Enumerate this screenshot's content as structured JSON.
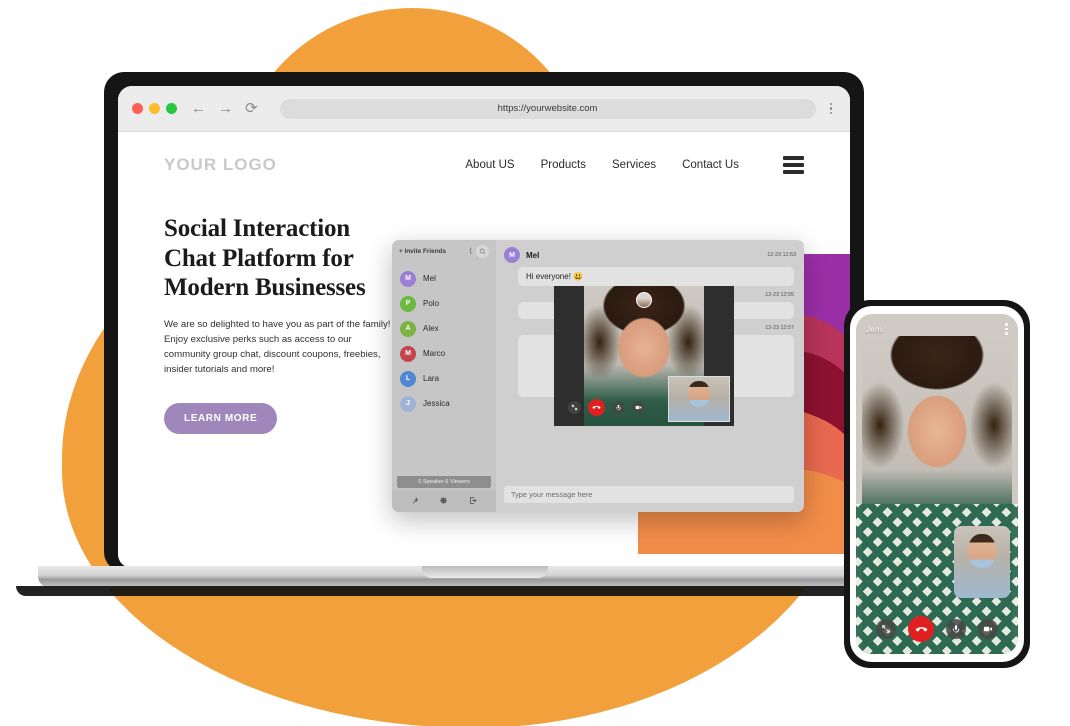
{
  "browser": {
    "url": "https://yourwebsite.com",
    "back_icon": "←",
    "forward_icon": "→",
    "reload_icon": "⟳",
    "menu_icon": "kebab-menu-icon",
    "traffic_lights": [
      "close",
      "minimize",
      "maximize"
    ]
  },
  "site": {
    "logo": "YOUR LOGO",
    "nav": [
      {
        "label": "About US"
      },
      {
        "label": "Products"
      },
      {
        "label": "Services"
      },
      {
        "label": "Contact Us"
      }
    ],
    "menu_icon": "hamburger-icon"
  },
  "hero": {
    "heading": "Social Interaction Chat Platform for Modern Businesses",
    "body": "We are so delighted to have you as part of the family! Enjoy exclusive perks such as access to our community group chat, discount coupons, freebies, insider tutorials and more!",
    "cta_label": "LEARN MORE",
    "cta_color": "#9f87bb"
  },
  "chat_app": {
    "sidebar": {
      "invite_label": "+ Invite Friends",
      "collapse_icon": "chevron-left-icon",
      "search_icon": "search-icon",
      "contacts": [
        {
          "initial": "M",
          "name": "Mel",
          "color": "#9b7fd4"
        },
        {
          "initial": "P",
          "name": "Polo",
          "color": "#6cb93f"
        },
        {
          "initial": "A",
          "name": "Alex",
          "color": "#7cb342"
        },
        {
          "initial": "M",
          "name": "Marco",
          "color": "#c3444f"
        },
        {
          "initial": "L",
          "name": "Lara",
          "color": "#4f86d6"
        },
        {
          "initial": "J",
          "name": "Jessica",
          "color": "#9fb4d4"
        }
      ],
      "status": "0 Speaker 6 Viewers",
      "tools": [
        "pin-icon",
        "gear-icon",
        "exit-icon"
      ]
    },
    "conversation": {
      "sender": {
        "initial": "M",
        "name": "Mel",
        "color": "#9b7fd4"
      },
      "messages": [
        {
          "text": "Hi everyone! 😃",
          "timestamp": "12-23 12:53"
        },
        {
          "text": "",
          "timestamp": "12-23 12:55"
        },
        {
          "text": "",
          "timestamp": "12-23 12:57"
        }
      ],
      "composer_placeholder": "Type your message here"
    },
    "video_call": {
      "controls": [
        "screen-share-icon",
        "end-call-icon",
        "microphone-icon",
        "camera-icon"
      ],
      "end_call_color": "#e02020"
    }
  },
  "phone": {
    "caller_name": "Jem",
    "menu_icon": "kebab-menu-icon",
    "controls": [
      "expand-icon",
      "end-call-icon",
      "microphone-icon",
      "camera-icon"
    ],
    "end_call_color": "#e02020"
  },
  "theme": {
    "orange": "#F2A03C",
    "purple": "#9f87bb"
  }
}
